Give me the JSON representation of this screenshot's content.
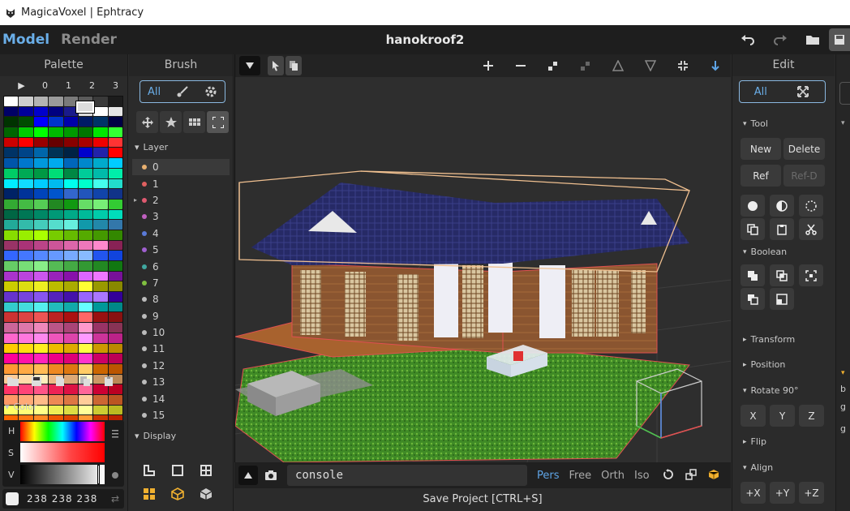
{
  "window": {
    "title": "MagicaVoxel | Ephtracy"
  },
  "topbar": {
    "mode_model": "Model",
    "mode_render": "Render",
    "project": "hanokroof2"
  },
  "palette": {
    "title": "Palette",
    "header": [
      "▶",
      "0",
      "1",
      "2",
      "3"
    ],
    "colors": [
      "#ffffff",
      "#cfcfcf",
      "#b3b3b3",
      "#9a9a9a",
      "#7a7a7a",
      "#5a5a5a",
      "#3a3a3a",
      "#1c1c1c",
      "#000066",
      "#000099",
      "#0000cc",
      "#000080",
      "#1a1a8c",
      "#dcdcdc",
      "#ffffff",
      "#e6e6e6",
      "#003300",
      "#004d00",
      "#0000ff",
      "#0033cc",
      "#0000aa",
      "#001a66",
      "#003366",
      "#000044",
      "#006600",
      "#00cc00",
      "#00ff00",
      "#00bb00",
      "#009900",
      "#007700",
      "#00e600",
      "#33ff33",
      "#cc0000",
      "#ff0000",
      "#990000",
      "#660000",
      "#880000",
      "#aa0000",
      "#ee0000",
      "#ff3333",
      "#003366",
      "#004488",
      "#0066aa",
      "#003355",
      "#002244",
      "#0000cc",
      "#2222aa",
      "#ff0000",
      "#0055aa",
      "#0077cc",
      "#0099dd",
      "#00aaee",
      "#0066bb",
      "#0088cc",
      "#00aacc",
      "#00ccff",
      "#00cc66",
      "#00aa55",
      "#009944",
      "#00dd77",
      "#008844",
      "#00cc99",
      "#00bbaa",
      "#00eeaa",
      "#00eeff",
      "#11ddff",
      "#00ccff",
      "#00bbee",
      "#00ffee",
      "#00ffcc",
      "#44ffee",
      "#22ddcc",
      "#002266",
      "#003399",
      "#0044bb",
      "#0055cc",
      "#3366cc",
      "#2255bb",
      "#1144aa",
      "#113388",
      "#33aa33",
      "#44bb44",
      "#55cc55",
      "#228822",
      "#119911",
      "#66dd66",
      "#77ee77",
      "#33cc33",
      "#006644",
      "#007755",
      "#008866",
      "#009977",
      "#00aa88",
      "#00bb99",
      "#00ccaa",
      "#00ddbb",
      "#22aa99",
      "#33bbaa",
      "#44ccbb",
      "#55ddcc",
      "#66eedd",
      "#1199aa",
      "#2288aa",
      "#3377aa",
      "#88dd00",
      "#99ee00",
      "#aaff00",
      "#77cc00",
      "#66bb00",
      "#55aa00",
      "#449900",
      "#338800",
      "#993366",
      "#aa3377",
      "#bb4488",
      "#cc5599",
      "#dd66aa",
      "#ee77bb",
      "#ff88cc",
      "#882255",
      "#3366ff",
      "#4477ff",
      "#5588ff",
      "#6699ff",
      "#77aaff",
      "#88bbff",
      "#2255ee",
      "#1144dd",
      "#66cc66",
      "#77dd77",
      "#88ee88",
      "#55bb55",
      "#44aa44",
      "#339933",
      "#228822",
      "#117711",
      "#aa33cc",
      "#bb44dd",
      "#cc55ee",
      "#9922bb",
      "#8811aa",
      "#dd66ff",
      "#ee77ff",
      "#771199",
      "#cccc00",
      "#dddd11",
      "#eeee22",
      "#bbbb00",
      "#aaaa00",
      "#ffff33",
      "#999900",
      "#888800",
      "#6633cc",
      "#7744dd",
      "#8855ee",
      "#5522bb",
      "#4411aa",
      "#9966ff",
      "#aa77ff",
      "#330099",
      "#33cccc",
      "#44dddd",
      "#55eeee",
      "#22bbbb",
      "#11aaaa",
      "#66ffff",
      "#009999",
      "#008888",
      "#cc3333",
      "#dd4444",
      "#ee5555",
      "#bb2222",
      "#aa1111",
      "#ff6666",
      "#991111",
      "#881111",
      "#cc6699",
      "#dd77aa",
      "#ee88bb",
      "#bb5588",
      "#aa4477",
      "#ff99cc",
      "#993366",
      "#883355",
      "#ff66cc",
      "#ff77dd",
      "#ff88ee",
      "#ee55bb",
      "#dd44aa",
      "#ff99ff",
      "#cc3399",
      "#bb2288",
      "#ffcc00",
      "#ffdd11",
      "#ffee22",
      "#eebb00",
      "#ddaa00",
      "#ffff44",
      "#cc9900",
      "#bb8800",
      "#ff0099",
      "#ff11aa",
      "#ff22bb",
      "#ee0088",
      "#dd0077",
      "#ff33cc",
      "#cc0066",
      "#bb0055",
      "#ff9933",
      "#ffaa44",
      "#ffbb55",
      "#ee8822",
      "#dd7711",
      "#ffcc66",
      "#cc6600",
      "#bb5500",
      "#ffcc99",
      "#ffddaa",
      "#ffeebb",
      "#eebb88",
      "#ddaa77",
      "#ffffcc",
      "#cc9966",
      "#bb8855",
      "#ff3366",
      "#ff4477",
      "#ff5588",
      "#ee2255",
      "#dd1144",
      "#ff6699",
      "#cc0033",
      "#bb0022",
      "#ff9966",
      "#ffaa77",
      "#ffbb88",
      "#ee8855",
      "#dd7744",
      "#ffcc99",
      "#cc6633",
      "#bb5522",
      "#ffff66",
      "#ffff77",
      "#ffff88",
      "#eeee55",
      "#dddd44",
      "#ffff99",
      "#cccc33",
      "#bbbb22",
      "#ff6600",
      "#ff7711",
      "#ff8822",
      "#ee5500",
      "#dd4400",
      "#ff9933",
      "#cc3300",
      "#bb2200"
    ],
    "tools": [
      "folder-icon",
      "save-icon",
      "file-icon",
      "copy-icon",
      "paste-icon"
    ],
    "color_section": "Color",
    "hsv_labels": [
      "H",
      "S",
      "V"
    ],
    "rgb": "238 238 238"
  },
  "brush": {
    "title": "Brush",
    "all": "All",
    "layer_section": "Layer",
    "display_section": "Display",
    "layers": [
      {
        "label": "0",
        "color": "#e8b070"
      },
      {
        "label": "1",
        "color": "#e06060"
      },
      {
        "label": "2",
        "color": "#e05a70"
      },
      {
        "label": "3",
        "color": "#c060c0"
      },
      {
        "label": "4",
        "color": "#5a7ad8"
      },
      {
        "label": "5",
        "color": "#a060d0"
      },
      {
        "label": "6",
        "color": "#40a8a0"
      },
      {
        "label": "7",
        "color": "#80c040"
      },
      {
        "label": "8",
        "color": "#bbbbbb"
      },
      {
        "label": "9",
        "color": "#bbbbbb"
      },
      {
        "label": "10",
        "color": "#bbbbbb"
      },
      {
        "label": "11",
        "color": "#bbbbbb"
      },
      {
        "label": "12",
        "color": "#bbbbbb"
      },
      {
        "label": "13",
        "color": "#bbbbbb"
      },
      {
        "label": "14",
        "color": "#bbbbbb"
      },
      {
        "label": "15",
        "color": "#bbbbbb"
      }
    ]
  },
  "viewport": {
    "console": "console",
    "projections": [
      "Pers",
      "Free",
      "Orth",
      "Iso"
    ],
    "status": "Save Project [CTRL+S]"
  },
  "edit": {
    "title": "Edit",
    "all": "All",
    "tool_section": "Tool",
    "new": "New",
    "delete": "Delete",
    "ref": "Ref",
    "ref_d": "Ref-D",
    "boolean_section": "Boolean",
    "transform_section": "Transform",
    "position_section": "Position",
    "rotate_section": "Rotate 90°",
    "rot_x": "X",
    "rot_y": "Y",
    "rot_z": "Z",
    "flip_section": "Flip",
    "align_section": "Align",
    "align_x": "+X",
    "align_y": "+Y",
    "align_z": "+Z"
  },
  "rightstrip": {
    "letters": [
      "b",
      "g",
      "g"
    ]
  }
}
